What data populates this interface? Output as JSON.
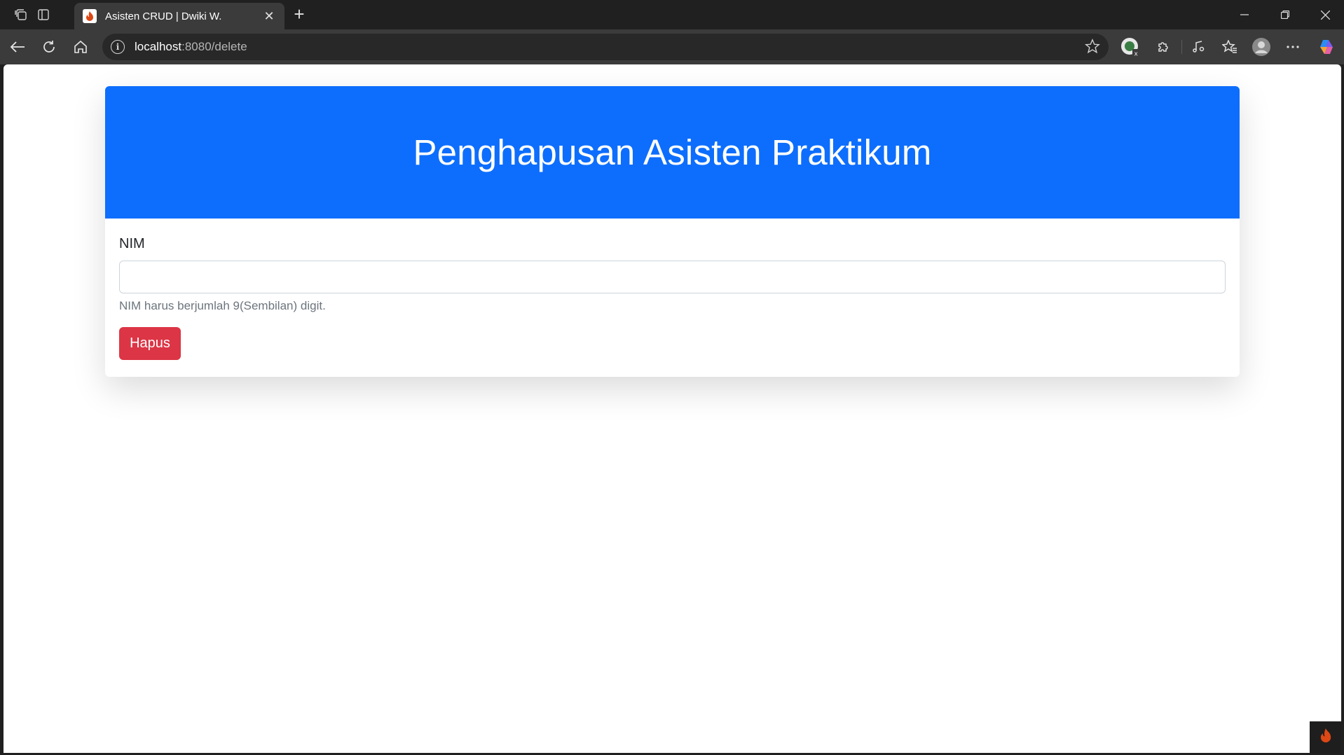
{
  "browser": {
    "tab": {
      "title": "Asisten CRUD | Dwiki W.",
      "favicon": "codeigniter-flame-icon"
    },
    "address": {
      "host": "localhost",
      "path": ":8080/delete"
    }
  },
  "page": {
    "heading": "Penghapusan Asisten Praktikum",
    "form": {
      "nim_label": "NIM",
      "nim_value": "",
      "nim_help": "NIM harus berjumlah 9(Sembilan) digit.",
      "submit_label": "Hapus"
    }
  },
  "colors": {
    "header_bg": "#0d6efd",
    "danger": "#dc3545",
    "debug_toolbar_flame": "#dd4814"
  }
}
